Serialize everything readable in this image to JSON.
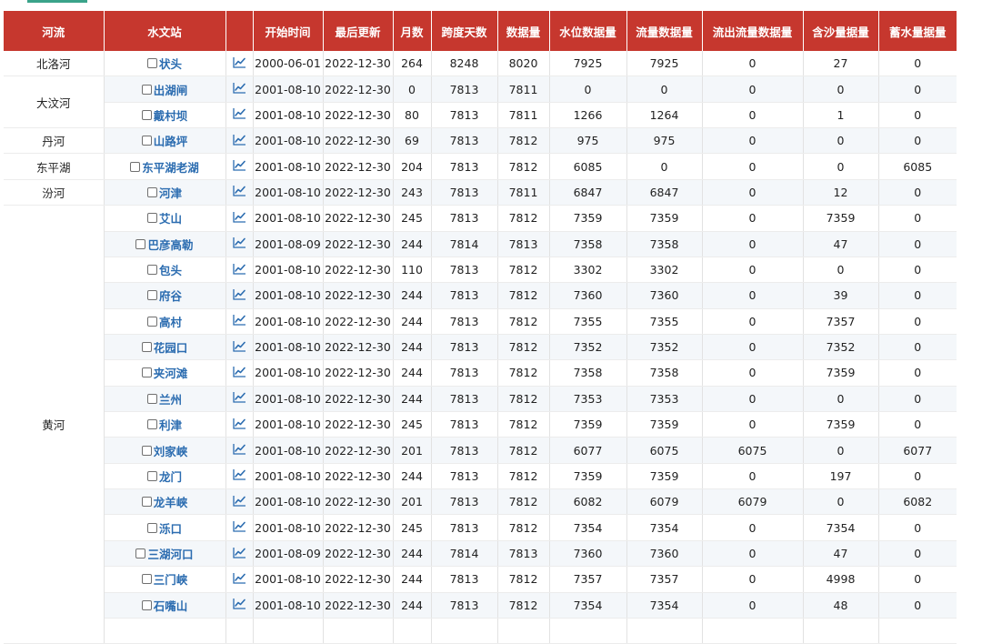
{
  "header": {
    "columns": [
      "河流",
      "水文站",
      "",
      "开始时间",
      "最后更新",
      "月数",
      "跨度天数",
      "数据量",
      "水位数据量",
      "流量数据量",
      "流出流量数据量",
      "含沙量据量",
      "蓄水量据量"
    ]
  },
  "icons": {
    "trend": "trend-chart-icon",
    "checkbox": "checkbox-icon"
  },
  "colors": {
    "header_bg": "#c6372e",
    "header_text": "#ffffff",
    "link": "#2b6cb0",
    "accent": "#3aa38a"
  },
  "rivers": [
    {
      "name": "北洛河",
      "rowspan": 1
    },
    {
      "name": "大汶河",
      "rowspan": 2
    },
    {
      "name": "丹河",
      "rowspan": 1
    },
    {
      "name": "东平湖",
      "rowspan": 1
    },
    {
      "name": "汾河",
      "rowspan": 1
    },
    {
      "name": "黄河",
      "rowspan": 17
    }
  ],
  "rows": [
    {
      "station": "状头",
      "start": "2000-06-01",
      "last": "2022-12-30",
      "months": "264",
      "span": "8248",
      "count": "8020",
      "level": "7925",
      "flow": "7925",
      "outflow": "0",
      "sediment": "27",
      "storage": "0"
    },
    {
      "station": "出湖闸",
      "start": "2001-08-10",
      "last": "2022-12-30",
      "months": "0",
      "span": "7813",
      "count": "7811",
      "level": "0",
      "flow": "0",
      "outflow": "0",
      "sediment": "0",
      "storage": "0"
    },
    {
      "station": "戴村坝",
      "start": "2001-08-10",
      "last": "2022-12-30",
      "months": "80",
      "span": "7813",
      "count": "7811",
      "level": "1266",
      "flow": "1264",
      "outflow": "0",
      "sediment": "1",
      "storage": "0"
    },
    {
      "station": "山路坪",
      "start": "2001-08-10",
      "last": "2022-12-30",
      "months": "69",
      "span": "7813",
      "count": "7812",
      "level": "975",
      "flow": "975",
      "outflow": "0",
      "sediment": "0",
      "storage": "0"
    },
    {
      "station": "东平湖老湖",
      "start": "2001-08-10",
      "last": "2022-12-30",
      "months": "204",
      "span": "7813",
      "count": "7812",
      "level": "6085",
      "flow": "0",
      "outflow": "0",
      "sediment": "0",
      "storage": "6085"
    },
    {
      "station": "河津",
      "start": "2001-08-10",
      "last": "2022-12-30",
      "months": "243",
      "span": "7813",
      "count": "7811",
      "level": "6847",
      "flow": "6847",
      "outflow": "0",
      "sediment": "12",
      "storage": "0"
    },
    {
      "station": "艾山",
      "start": "2001-08-10",
      "last": "2022-12-30",
      "months": "245",
      "span": "7813",
      "count": "7812",
      "level": "7359",
      "flow": "7359",
      "outflow": "0",
      "sediment": "7359",
      "storage": "0"
    },
    {
      "station": "巴彦高勒",
      "start": "2001-08-09",
      "last": "2022-12-30",
      "months": "244",
      "span": "7814",
      "count": "7813",
      "level": "7358",
      "flow": "7358",
      "outflow": "0",
      "sediment": "47",
      "storage": "0"
    },
    {
      "station": "包头",
      "start": "2001-08-10",
      "last": "2022-12-30",
      "months": "110",
      "span": "7813",
      "count": "7812",
      "level": "3302",
      "flow": "3302",
      "outflow": "0",
      "sediment": "0",
      "storage": "0"
    },
    {
      "station": "府谷",
      "start": "2001-08-10",
      "last": "2022-12-30",
      "months": "244",
      "span": "7813",
      "count": "7812",
      "level": "7360",
      "flow": "7360",
      "outflow": "0",
      "sediment": "39",
      "storage": "0"
    },
    {
      "station": "高村",
      "start": "2001-08-10",
      "last": "2022-12-30",
      "months": "244",
      "span": "7813",
      "count": "7812",
      "level": "7355",
      "flow": "7355",
      "outflow": "0",
      "sediment": "7357",
      "storage": "0"
    },
    {
      "station": "花园口",
      "start": "2001-08-10",
      "last": "2022-12-30",
      "months": "244",
      "span": "7813",
      "count": "7812",
      "level": "7352",
      "flow": "7352",
      "outflow": "0",
      "sediment": "7352",
      "storage": "0"
    },
    {
      "station": "夹河滩",
      "start": "2001-08-10",
      "last": "2022-12-30",
      "months": "244",
      "span": "7813",
      "count": "7812",
      "level": "7358",
      "flow": "7358",
      "outflow": "0",
      "sediment": "7359",
      "storage": "0"
    },
    {
      "station": "兰州",
      "start": "2001-08-10",
      "last": "2022-12-30",
      "months": "244",
      "span": "7813",
      "count": "7812",
      "level": "7353",
      "flow": "7353",
      "outflow": "0",
      "sediment": "0",
      "storage": "0"
    },
    {
      "station": "利津",
      "start": "2001-08-10",
      "last": "2022-12-30",
      "months": "245",
      "span": "7813",
      "count": "7812",
      "level": "7359",
      "flow": "7359",
      "outflow": "0",
      "sediment": "7359",
      "storage": "0"
    },
    {
      "station": "刘家峡",
      "start": "2001-08-10",
      "last": "2022-12-30",
      "months": "201",
      "span": "7813",
      "count": "7812",
      "level": "6077",
      "flow": "6075",
      "outflow": "6075",
      "sediment": "0",
      "storage": "6077"
    },
    {
      "station": "龙门",
      "start": "2001-08-10",
      "last": "2022-12-30",
      "months": "244",
      "span": "7813",
      "count": "7812",
      "level": "7359",
      "flow": "7359",
      "outflow": "0",
      "sediment": "197",
      "storage": "0"
    },
    {
      "station": "龙羊峡",
      "start": "2001-08-10",
      "last": "2022-12-30",
      "months": "201",
      "span": "7813",
      "count": "7812",
      "level": "6082",
      "flow": "6079",
      "outflow": "6079",
      "sediment": "0",
      "storage": "6082"
    },
    {
      "station": "泺口",
      "start": "2001-08-10",
      "last": "2022-12-30",
      "months": "245",
      "span": "7813",
      "count": "7812",
      "level": "7354",
      "flow": "7354",
      "outflow": "0",
      "sediment": "7354",
      "storage": "0"
    },
    {
      "station": "三湖河口",
      "start": "2001-08-09",
      "last": "2022-12-30",
      "months": "244",
      "span": "7814",
      "count": "7813",
      "level": "7360",
      "flow": "7360",
      "outflow": "0",
      "sediment": "47",
      "storage": "0"
    },
    {
      "station": "三门峡",
      "start": "2001-08-10",
      "last": "2022-12-30",
      "months": "244",
      "span": "7813",
      "count": "7812",
      "level": "7357",
      "flow": "7357",
      "outflow": "0",
      "sediment": "4998",
      "storage": "0"
    },
    {
      "station": "石嘴山",
      "start": "2001-08-10",
      "last": "2022-12-30",
      "months": "244",
      "span": "7813",
      "count": "7812",
      "level": "7354",
      "flow": "7354",
      "outflow": "0",
      "sediment": "48",
      "storage": "0"
    },
    {
      "station": "",
      "start": "",
      "last": "",
      "months": "",
      "span": "",
      "count": "",
      "level": "",
      "flow": "",
      "outflow": "",
      "sediment": "",
      "storage": ""
    }
  ]
}
